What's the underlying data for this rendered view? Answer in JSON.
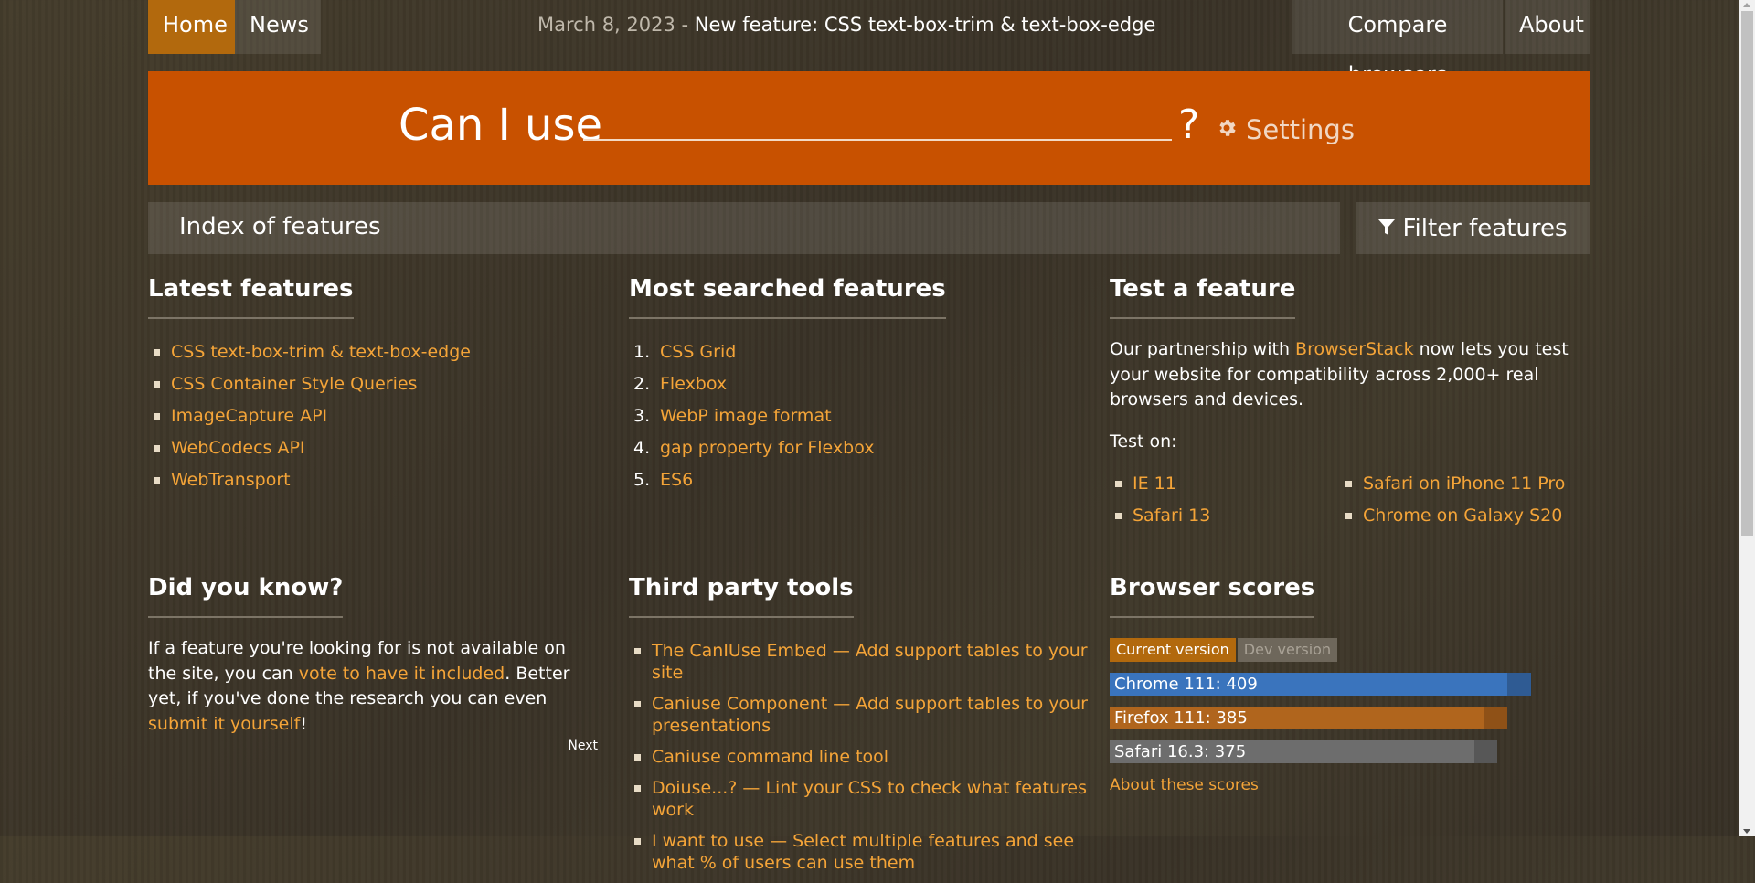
{
  "nav": {
    "home": "Home",
    "news": "News",
    "compare": "Compare browsers",
    "about": "About",
    "news_date": "March 8, 2023",
    "news_sep": " - ",
    "news_headline": "New feature: CSS text-box-trim & text-box-edge"
  },
  "search": {
    "label": "Can I use",
    "value": "",
    "placeholder": "",
    "qmark": "?",
    "settings": "Settings"
  },
  "index": {
    "title": "Index of features",
    "filter": "Filter features"
  },
  "latest": {
    "title": "Latest features",
    "items": [
      "CSS text-box-trim & text-box-edge",
      "CSS Container Style Queries",
      "ImageCapture API",
      "WebCodecs API",
      "WebTransport"
    ]
  },
  "most_searched": {
    "title": "Most searched features",
    "items": [
      {
        "num": "1.",
        "label": "CSS Grid"
      },
      {
        "num": "2.",
        "label": "Flexbox"
      },
      {
        "num": "3.",
        "label": "WebP image format"
      },
      {
        "num": "4.",
        "label": "gap property for Flexbox"
      },
      {
        "num": "5.",
        "label": "ES6"
      }
    ]
  },
  "test": {
    "title": "Test a feature",
    "p1_a": "Our partnership with ",
    "p1_link": "BrowserStack",
    "p1_b": " now lets you test your website for compatibility across 2,000+ real browsers and devices.",
    "test_on": "Test on:",
    "left": [
      "IE 11",
      "Safari 13"
    ],
    "right": [
      "Safari on iPhone 11 Pro",
      "Chrome on Galaxy S20"
    ]
  },
  "didyouknow": {
    "title": "Did you know?",
    "a": "If a feature you're looking for is not available on the site, you can ",
    "link1": "vote to have it included",
    "b": ". Better yet, if you've done the research you can even ",
    "link2": "submit it yourself",
    "c": "!",
    "next": "Next"
  },
  "third_party": {
    "title": "Third party tools",
    "items": [
      "The CanIUse Embed — Add support tables to your site",
      "Caniuse Component — Add support tables to your presentations",
      "Caniuse command line tool",
      "Doiuse...? — Lint your CSS to check what features work",
      "I want to use — Select multiple features and see what % of users can use them"
    ]
  },
  "scores": {
    "title": "Browser scores",
    "tab_current": "Current version",
    "tab_dev": "Dev version",
    "items": [
      {
        "label": "Chrome 111: 409",
        "score": 409,
        "color": "#3a74bd",
        "track": "#2f5b93"
      },
      {
        "label": "Firefox 111: 385",
        "score": 385,
        "color": "#b0651d",
        "track": "#8f5117"
      },
      {
        "label": "Safari 16.3: 375",
        "score": 375,
        "color": "#6d6d6d",
        "track": "#575757"
      }
    ],
    "max_score": 440,
    "about": "About these scores"
  }
}
